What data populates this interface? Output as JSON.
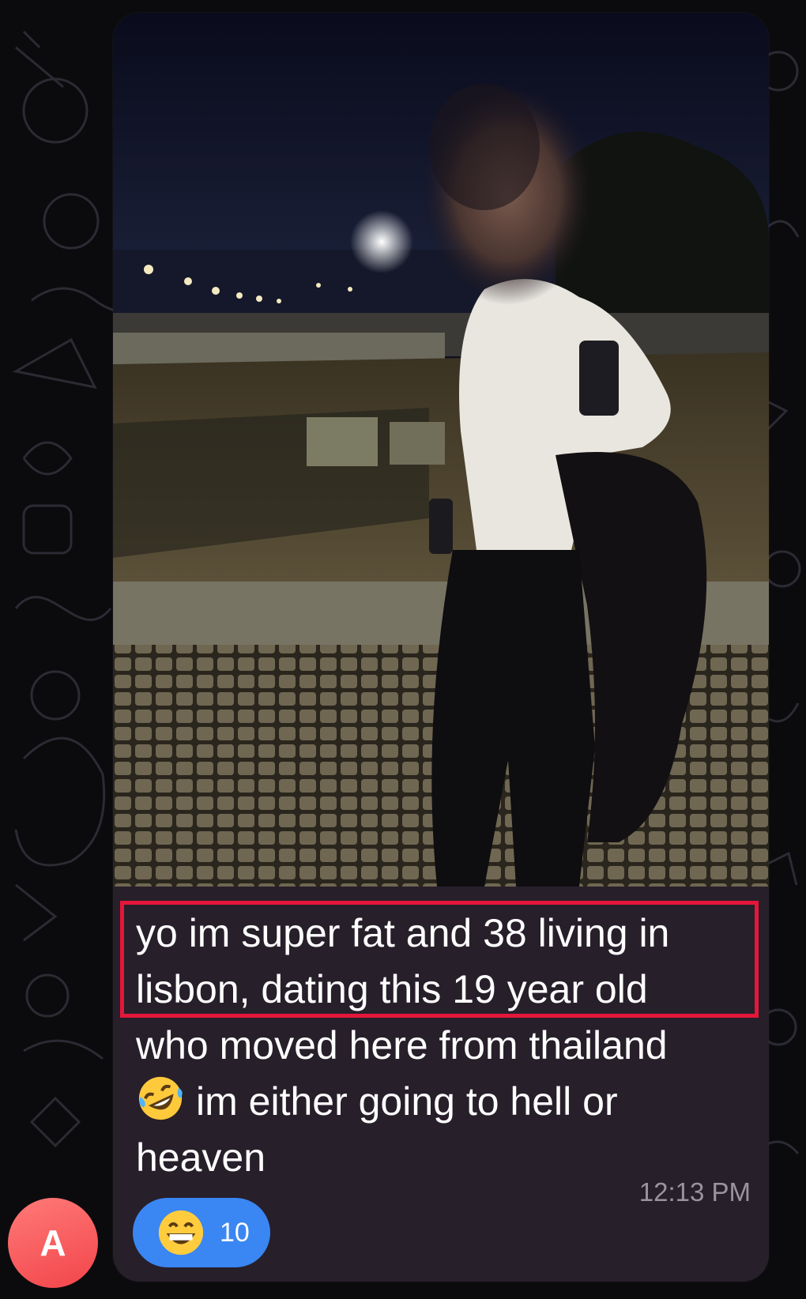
{
  "message": {
    "caption_lines": [
      "yo im super fat and 38 living in",
      "lisbon, dating this 19 year old",
      "who moved here from thailand",
      "im either going to hell or",
      "heaven"
    ],
    "reaction": {
      "emoji": "grinning-face",
      "count": "10"
    },
    "timestamp": "12:13 PM",
    "sender_avatar_initial": "A"
  },
  "colors": {
    "bubble": "#271f2a",
    "reaction_pill": "#3a86f3",
    "highlight_box": "#e4163a",
    "avatar": "#f2454a",
    "timestamp": "#9a94a0"
  }
}
